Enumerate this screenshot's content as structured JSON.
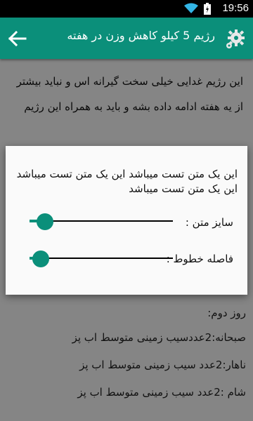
{
  "status_bar": {
    "time": "19:56"
  },
  "app_bar": {
    "title": "رژیم 5 کیلو کاهش وزن در هفته",
    "back_icon": "arrow-left-icon",
    "settings_icon": "gear-icon"
  },
  "article": {
    "intro": "این رژیم غدایی خیلی سخت گیرانه اس و نباید بیشتر از یه هفته ادامه داده بشه و باید به همراه این رژیم",
    "lines": [
      "روز دوم:",
      "صبحانه:2عددسیب زمینی متوسط اب پز",
      "ناهار:2عدد سیب زمینی متوسط اب پز",
      "شام :2عدد سیب زمینی متوسط اب پز"
    ]
  },
  "dialog": {
    "sample_text": "این یک متن تست میباشد این یک متن تست میباشد این یک متن تست میباشد",
    "font_size_label": "سایز متن :",
    "line_spacing_label": "فاصله خطوط :",
    "font_size_level": 0.11,
    "line_spacing_level": 0.08
  },
  "colors": {
    "accent": "#0b8f7a",
    "status_bar": "#000000",
    "dialog_bg": "#fafafa"
  }
}
